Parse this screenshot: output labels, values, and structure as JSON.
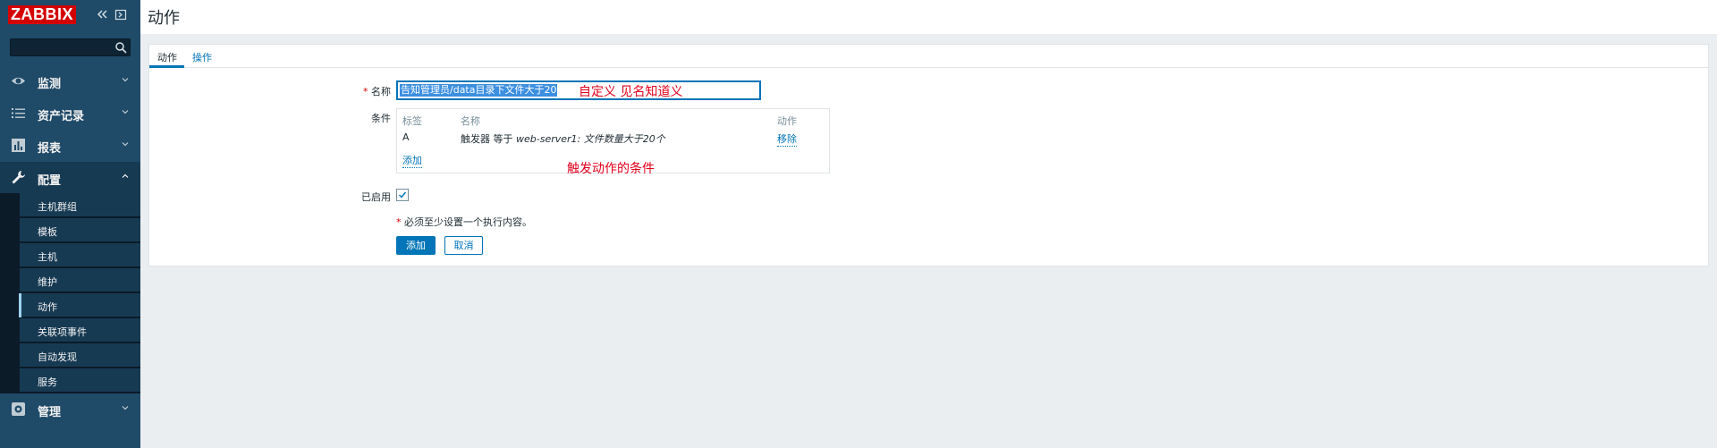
{
  "sidebar": {
    "logo": "ZABBIX",
    "search_placeholder": "",
    "menu": {
      "monitoring": "监测",
      "inventory": "资产记录",
      "reports": "报表",
      "configuration": "配置",
      "administration": "管理"
    },
    "config_items": [
      "主机群组",
      "模板",
      "主机",
      "维护",
      "动作",
      "关联项事件",
      "自动发现",
      "服务"
    ],
    "active_item": "动作"
  },
  "header": {
    "title": "动作"
  },
  "tabs": {
    "action": "动作",
    "operations": "操作",
    "active": "动作"
  },
  "form": {
    "name_label": "名称",
    "name_value": "告知管理员/data目录下文件大于20",
    "conditions_label": "条件",
    "conditions": {
      "col_label": "标签",
      "col_name": "名称",
      "col_action": "动作",
      "rows": [
        {
          "label": "A",
          "name_prefix": "触发器 等于 ",
          "name_detail": "web-server1: 文件数量大于20个",
          "action": "移除"
        }
      ],
      "add_link": "添加"
    },
    "enabled_label": "已启用",
    "enabled": true,
    "warning": "必须至少设置一个执行内容。",
    "add_button": "添加",
    "cancel_button": "取消"
  },
  "annotations": {
    "name_note": "自定义  见名知道义",
    "condition_note": "触发动作的条件"
  },
  "colors": {
    "sidebar_bg": "#1f4a68",
    "accent": "#0275b8",
    "logo_red": "#d40000",
    "annotation_red": "#e0001b"
  }
}
